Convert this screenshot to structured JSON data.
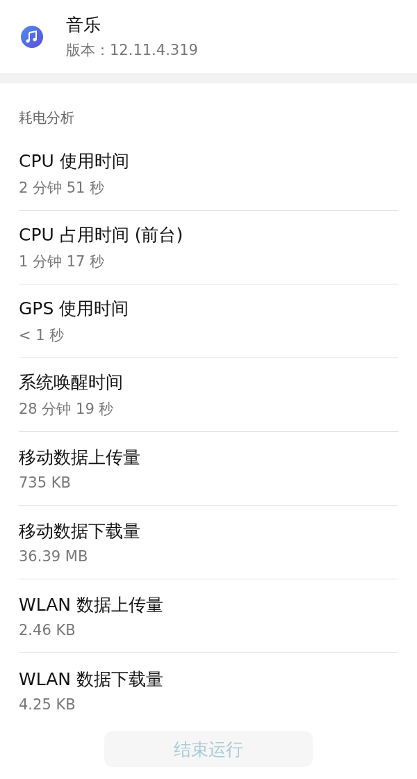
{
  "app": {
    "name": "音乐",
    "version": "版本：12.11.4.319"
  },
  "section": {
    "title": "耗电分析"
  },
  "items": [
    {
      "label": "CPU 使用时间",
      "value": "2 分钟 51 秒"
    },
    {
      "label": "CPU 占用时间 (前台)",
      "value": "1 分钟 17 秒"
    },
    {
      "label": "GPS 使用时间",
      "value": "< 1 秒"
    },
    {
      "label": "系统唤醒时间",
      "value": "28 分钟 19 秒"
    },
    {
      "label": "移动数据上传量",
      "value": "735 KB"
    },
    {
      "label": "移动数据下载量",
      "value": "36.39 MB"
    },
    {
      "label": "WLAN 数据上传量",
      "value": "2.46 KB"
    },
    {
      "label": "WLAN 数据下载量",
      "value": "4.25 KB"
    }
  ],
  "button": {
    "label": "结束运行",
    "disabled": true
  }
}
